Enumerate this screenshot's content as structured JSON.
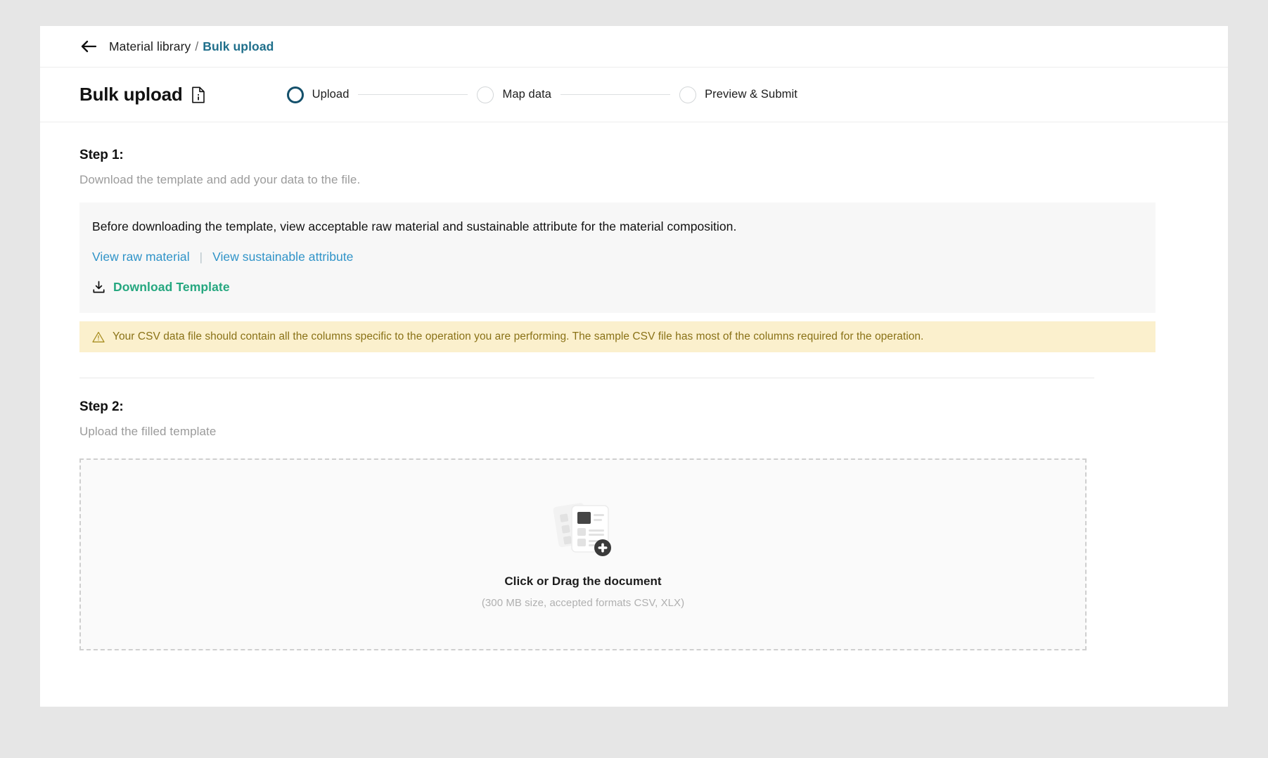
{
  "breadcrumb": {
    "back_icon": "arrow-left-icon",
    "root": "Material library",
    "separator": "/",
    "current": "Bulk upload"
  },
  "header": {
    "title": "Bulk upload",
    "title_icon": "file-info-icon",
    "accent_active": "#14506b",
    "accent_link": "#2f93c8",
    "accent_green": "#25a77f"
  },
  "stepper": {
    "steps": [
      {
        "label": "Upload",
        "state": "active"
      },
      {
        "label": "Map data",
        "state": "inactive"
      },
      {
        "label": "Preview & Submit",
        "state": "inactive"
      }
    ]
  },
  "step1": {
    "heading": "Step 1:",
    "subtitle": "Download the template and add your data to the file.",
    "panel": {
      "title": "Before downloading the template, view acceptable raw material and sustainable attribute for the material composition.",
      "link_raw_material": "View raw material",
      "link_separator": "|",
      "link_sustainable_attribute": "View sustainable attribute",
      "download_icon": "download-icon",
      "download_label": "Download Template"
    },
    "warning": {
      "icon": "warning-triangle-icon",
      "text": "Your CSV data file should contain all the columns specific to the operation you are performing. The sample CSV file has most of the columns required for the operation.",
      "background": "#fbf0cd",
      "text_color": "#8a7217"
    }
  },
  "step2": {
    "heading": "Step 2:",
    "subtitle": "Upload the filled template",
    "dropzone": {
      "icon": "documents-add-icon",
      "title": "Click or Drag the document",
      "hint": "(300 MB size, accepted formats CSV, XLX)"
    }
  }
}
